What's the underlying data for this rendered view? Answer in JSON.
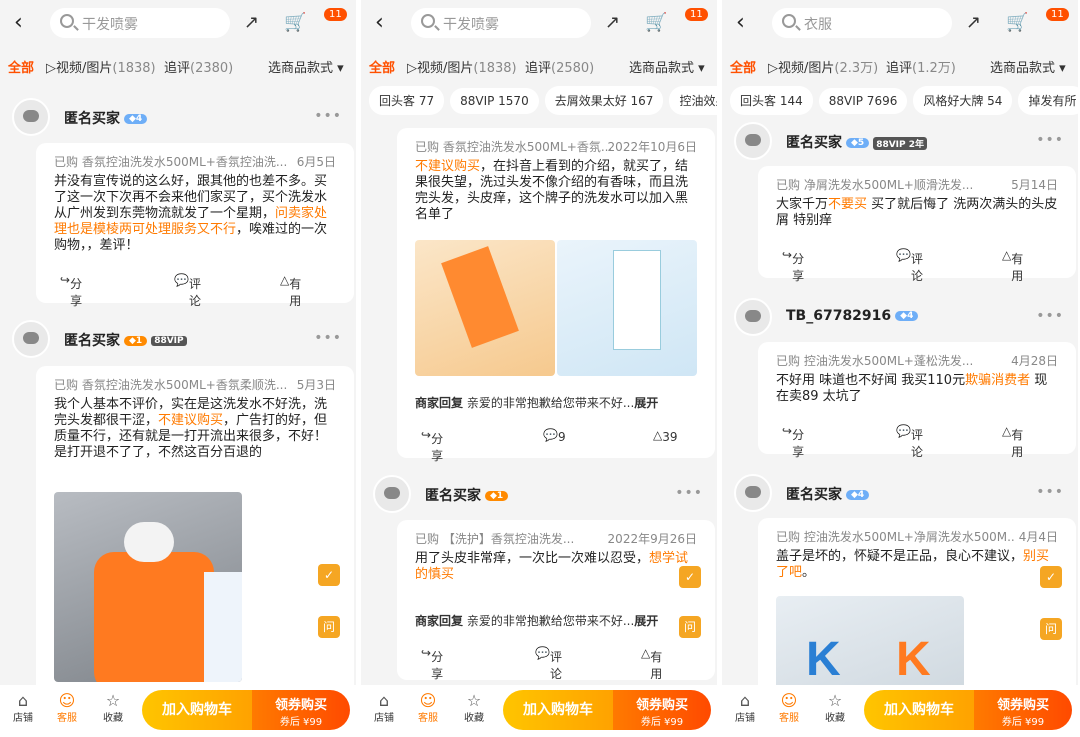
{
  "common": {
    "cart_badge": "11",
    "tab_all": "全部",
    "tab_media": "视频/图片",
    "tab_follow": "追评",
    "tab_style": "选商品款式 ▾",
    "share": "分享",
    "comment": "评论",
    "useful": "有用",
    "merchant": "商家回复",
    "reply_text": "亲爱的非常抱歉给您带来不好...",
    "expand": "展开",
    "nav_store": "店铺",
    "nav_service": "客服",
    "nav_fav": "收藏",
    "add_cart": "加入购物车",
    "buy": "领券购买",
    "coupon_price": "券后 ¥99",
    "anon": "匿名买家",
    "q_icon": "问"
  },
  "p0": {
    "search": "干发喷雾",
    "media_count": "(1838)",
    "follow_count": "(2380)",
    "r1": {
      "bought": "已购 香氛控油洗发水500ML+香氛控油洗...",
      "date": "6月5日",
      "t1": "并没有宣传说的这么好，跟其他的也差不多。买了这一次下次再不会来他们家买了，买个洗发水从广州发到东莞物流就发了一个星期，",
      "t2": "问卖家处理也是模棱两可处理服务又不行",
      "t3": "，唉难过的一次购物，，差评！"
    },
    "r2": {
      "bought": "已购 香氛控油洗发水500ML+香氛柔顺洗...",
      "date": "5月3日",
      "t1": "我个人基本不评价，实在是这洗发水不好洗，洗完头发都很干涩，",
      "t2": "不建议购买",
      "t3": "，广告打的好，但质量不行，还有就是一打开流出来很多，不好！  是打开退不了了，不然这百分百退的"
    }
  },
  "p1": {
    "search": "干发喷雾",
    "media_count": "(1838)",
    "follow_count": "(2580)",
    "chips": [
      "回头客 77",
      "88VIP 1570",
      "去屑效果太好 167",
      "控油效果"
    ],
    "r1": {
      "bought": "已购 香氛控油洗发水500ML+香氛...",
      "date": "2022年10月6日",
      "t1": "不建议购买",
      "t2": "，在抖音上看到的介绍，就买了，结果很失望，洗过头发不像介绍的有香味，而且洗完头发，头皮痒，这个牌子的洗发水可以加入黑名单了",
      "likes": "39",
      "comments": "9"
    },
    "r2": {
      "bought": "已购 【洗护】香氛控油洗发...",
      "date": "2022年9月26日",
      "t1": "用了头皮非常痒，一次比一次难以忍受，",
      "t2": "想学试的慎买"
    }
  },
  "p2": {
    "search": "衣服",
    "media_count": "(2.3万)",
    "follow_count": "(1.2万)",
    "chips": [
      "回头客 144",
      "88VIP 7696",
      "风格好大牌 54",
      "掉发有所"
    ],
    "r1": {
      "bought": "已购 净屑洗发水500ML+顺滑洗发...",
      "date": "5月14日",
      "t1": "大家千万",
      "t2": "不要买",
      "t3": " 买了就后悔了 洗两次满头的头皮屑 特别痒"
    },
    "r2": {
      "user": "TB_67782916",
      "bought": "已购 控油洗发水500ML+蓬松洗发...",
      "date": "4月28日",
      "t1": "不好用 味道也不好闻  我买110元",
      "t2": "欺骗消费者",
      "t3": " 现在卖89 太坑了"
    },
    "r3": {
      "bought": "已购 控油洗发水500ML+净屑洗发水500M...",
      "date": "4月4日",
      "t1": "盖子是坏的，怀疑不是正品，良心不建议，",
      "t2": "别买了吧",
      "t3": "。"
    }
  }
}
